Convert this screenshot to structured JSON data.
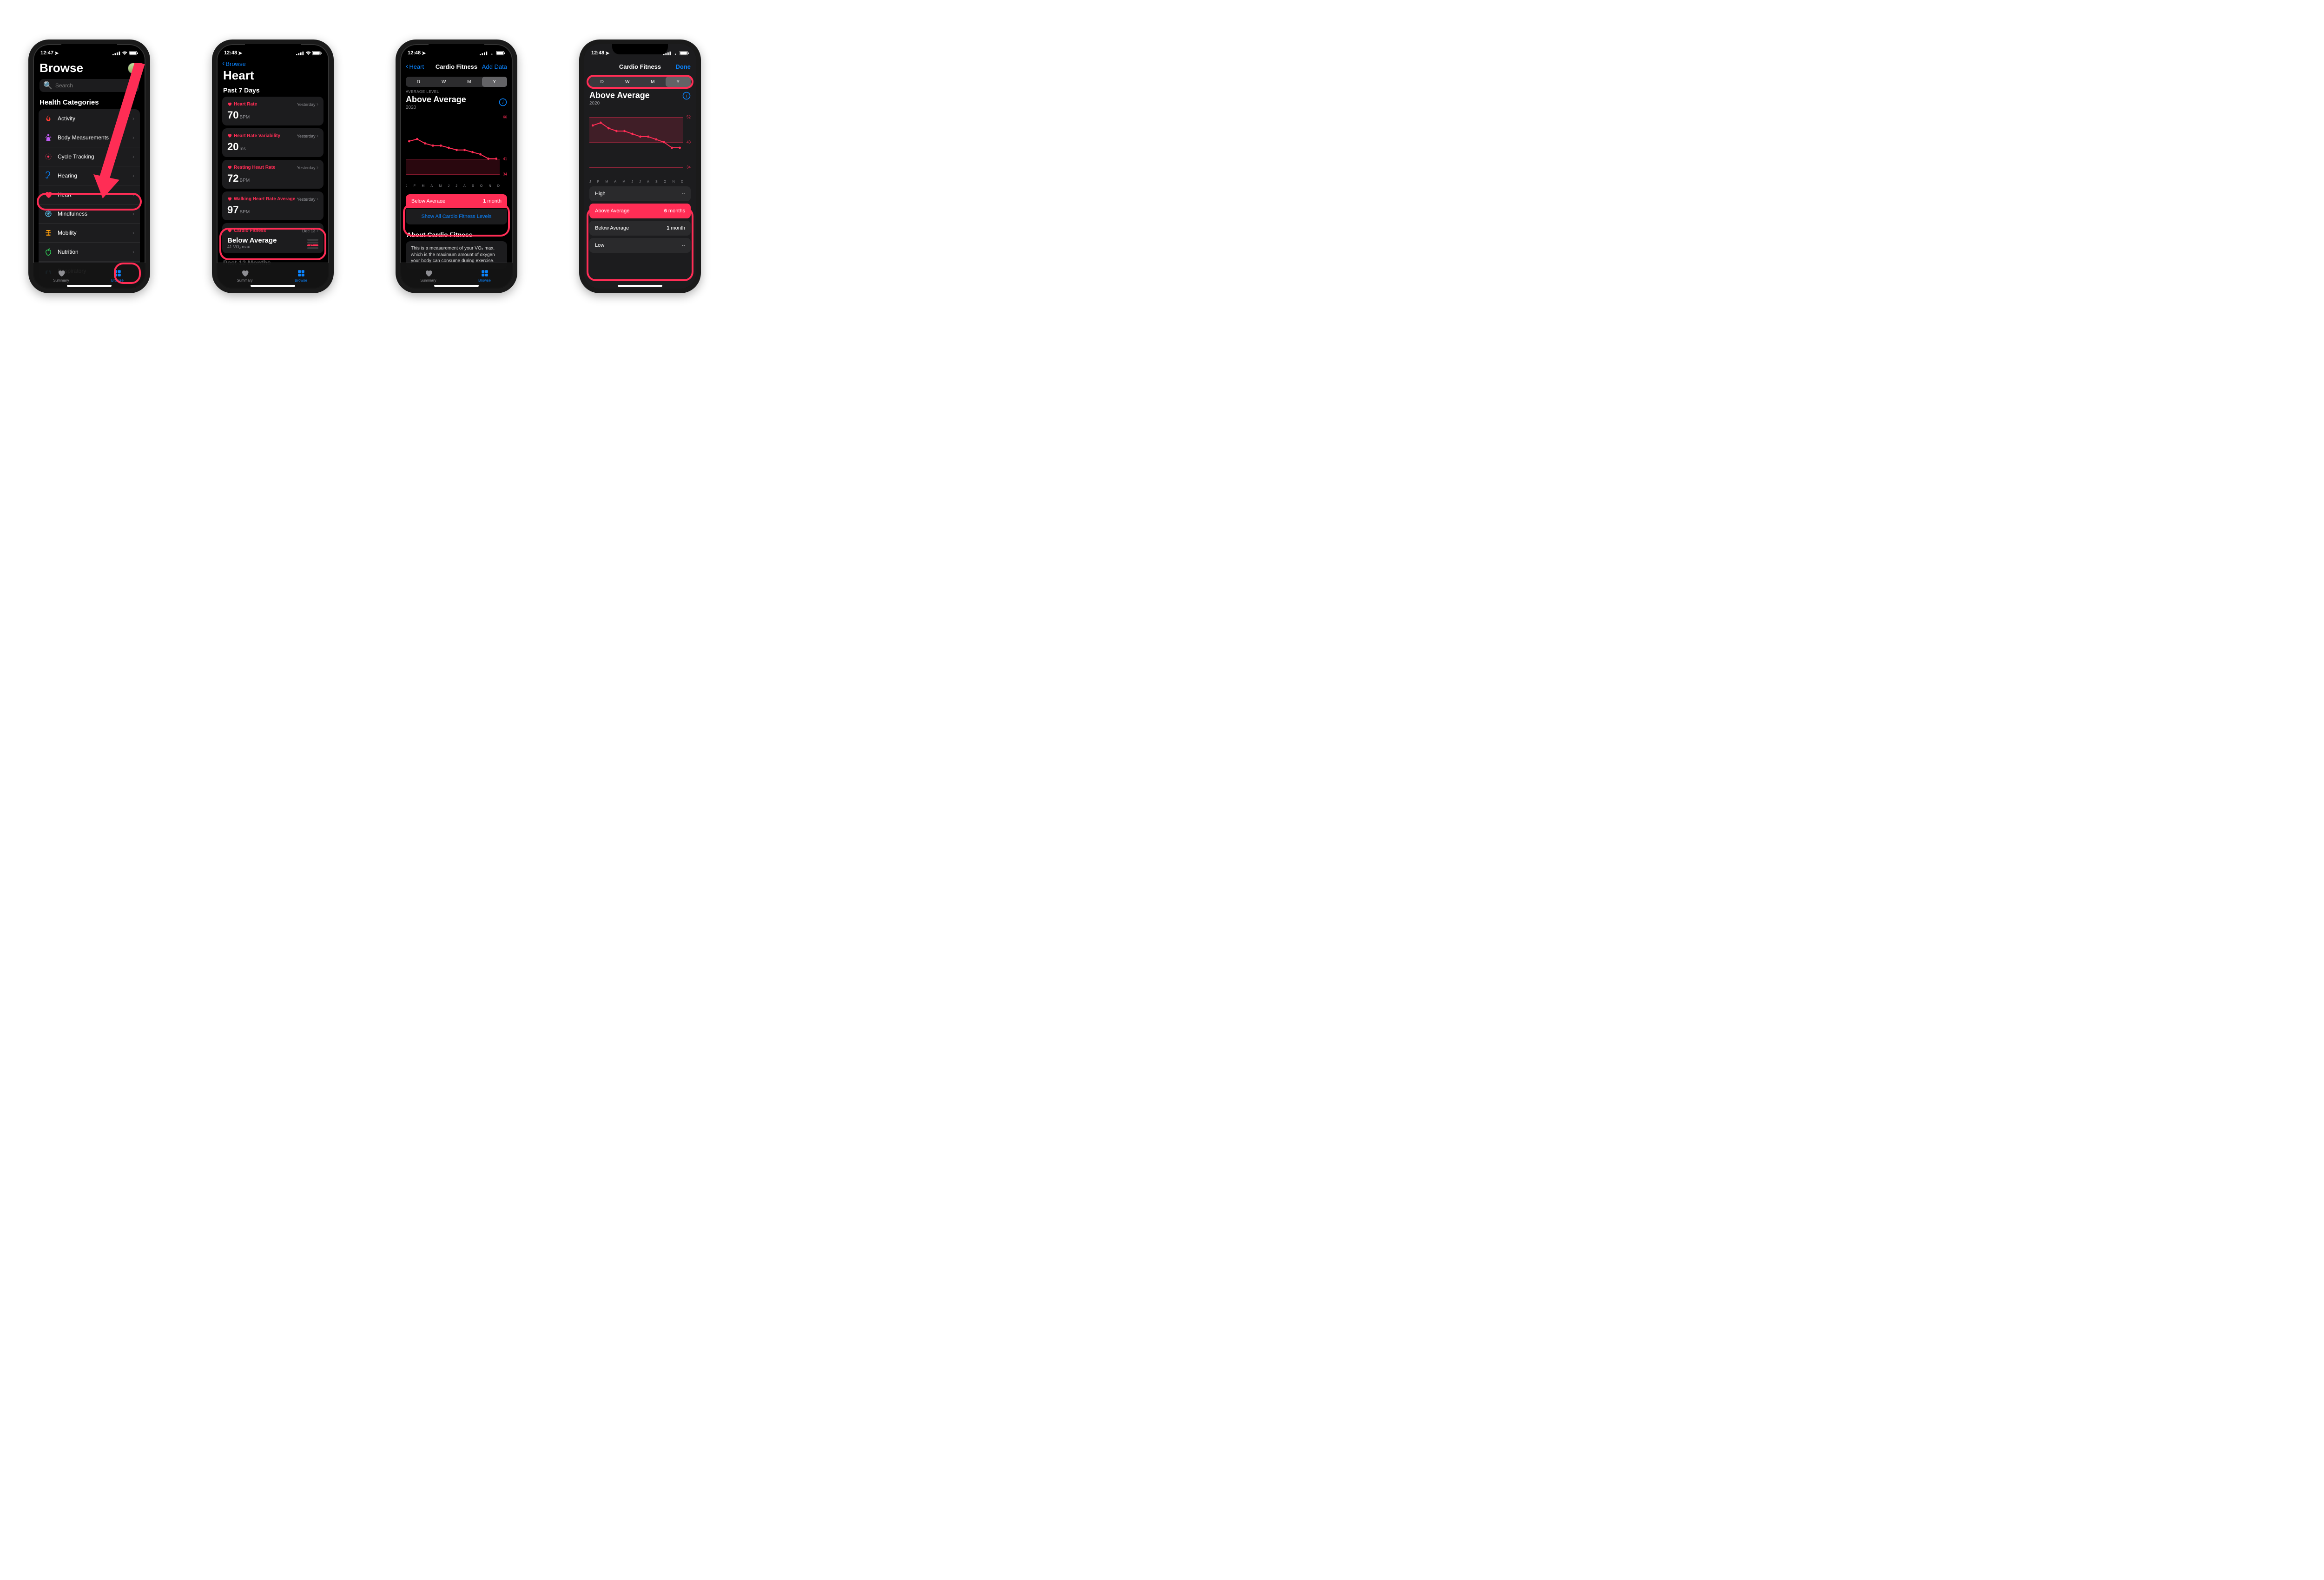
{
  "colors": {
    "accent_pink": "#ff2d55",
    "accent_blue": "#0a84ff"
  },
  "status": {
    "s1": "12:47",
    "s2": "12:48",
    "s3": "12:48",
    "s4": "12:48"
  },
  "tabbar": {
    "summary": "Summary",
    "browse": "Browse"
  },
  "screen1": {
    "title": "Browse",
    "search_placeholder": "Search",
    "section": "Health Categories",
    "items": [
      {
        "name": "activity",
        "label": "Activity"
      },
      {
        "name": "body-measurements",
        "label": "Body Measurements"
      },
      {
        "name": "cycle-tracking",
        "label": "Cycle Tracking"
      },
      {
        "name": "hearing",
        "label": "Hearing"
      },
      {
        "name": "heart",
        "label": "Heart"
      },
      {
        "name": "mindfulness",
        "label": "Mindfulness"
      },
      {
        "name": "mobility",
        "label": "Mobility"
      },
      {
        "name": "nutrition",
        "label": "Nutrition"
      },
      {
        "name": "respiratory",
        "label": "Respiratory"
      }
    ]
  },
  "screen2": {
    "back": "Browse",
    "title": "Heart",
    "section": "Past 7 Days",
    "next_section": "Past 12 Months",
    "metrics": [
      {
        "name": "heart-rate",
        "label": "Heart Rate",
        "when": "Yesterday",
        "value": "70",
        "unit": "BPM"
      },
      {
        "name": "heart-rate-variability",
        "label": "Heart Rate Variability",
        "when": "Yesterday",
        "value": "20",
        "unit": "ms"
      },
      {
        "name": "resting-heart-rate",
        "label": "Resting Heart Rate",
        "when": "Yesterday",
        "value": "72",
        "unit": "BPM"
      },
      {
        "name": "walking-heart-rate-avg",
        "label": "Walking Heart Rate Average",
        "when": "Yesterday",
        "value": "97",
        "unit": "BPM"
      }
    ],
    "cardio": {
      "label": "Cardio Fitness",
      "when": "Dec 13",
      "status": "Below Average",
      "detail": "41 VO₂ max"
    }
  },
  "screen3": {
    "back": "Heart",
    "title": "Cardio Fitness",
    "add": "Add Data",
    "segments": [
      "D",
      "W",
      "M",
      "Y"
    ],
    "selected_segment": 3,
    "level_label": "AVERAGE LEVEL",
    "level_value": "Above Average",
    "year": "2020",
    "below_row": {
      "label": "Below Average",
      "duration": "1 month",
      "duration_num": "1"
    },
    "show_all": "Show All Cardio Fitness Levels",
    "about_title": "About Cardio Fitness",
    "about_body": "This is a measurement of your VO₂ max, which is the maximum amount of oxygen your body can consume during exercise.",
    "months": [
      "J",
      "F",
      "M",
      "A",
      "M",
      "J",
      "J",
      "A",
      "S",
      "O",
      "N",
      "D"
    ]
  },
  "screen4": {
    "title": "Cardio Fitness",
    "done": "Done",
    "segments": [
      "D",
      "W",
      "M",
      "Y"
    ],
    "selected_segment": 3,
    "level_value": "Above Average",
    "year": "2020",
    "levels": [
      {
        "name": "high",
        "label": "High",
        "duration": "--",
        "num": ""
      },
      {
        "name": "above-average",
        "label": "Above Average",
        "duration": "months",
        "num": "6",
        "active": true
      },
      {
        "name": "below-average",
        "label": "Below Average",
        "duration": "month",
        "num": "1"
      },
      {
        "name": "low",
        "label": "Low",
        "duration": "--",
        "num": ""
      }
    ],
    "months": [
      "J",
      "F",
      "M",
      "A",
      "M",
      "J",
      "J",
      "A",
      "S",
      "O",
      "N",
      "D"
    ]
  },
  "chart_data": [
    {
      "type": "line",
      "title": "Above Average",
      "ylabel": "VO₂ max",
      "ylim": [
        30,
        62
      ],
      "gridlines": [
        34,
        41,
        60
      ],
      "band_range": [
        34,
        41
      ],
      "categories": [
        "J",
        "F",
        "M",
        "A",
        "M",
        "J",
        "J",
        "A",
        "S",
        "O",
        "N",
        "D"
      ],
      "values": [
        49,
        50,
        48,
        47,
        47,
        46,
        45,
        45,
        44,
        43,
        41,
        41
      ]
    },
    {
      "type": "line",
      "title": "Above Average",
      "ylabel": "VO₂ max",
      "ylim": [
        30,
        55
      ],
      "gridlines": [
        34,
        43,
        52
      ],
      "band_range": [
        43,
        52
      ],
      "categories": [
        "J",
        "F",
        "M",
        "A",
        "M",
        "J",
        "J",
        "A",
        "S",
        "O",
        "N",
        "D"
      ],
      "values": [
        49,
        50,
        48,
        47,
        47,
        46,
        45,
        45,
        44,
        43,
        41,
        41
      ]
    }
  ]
}
